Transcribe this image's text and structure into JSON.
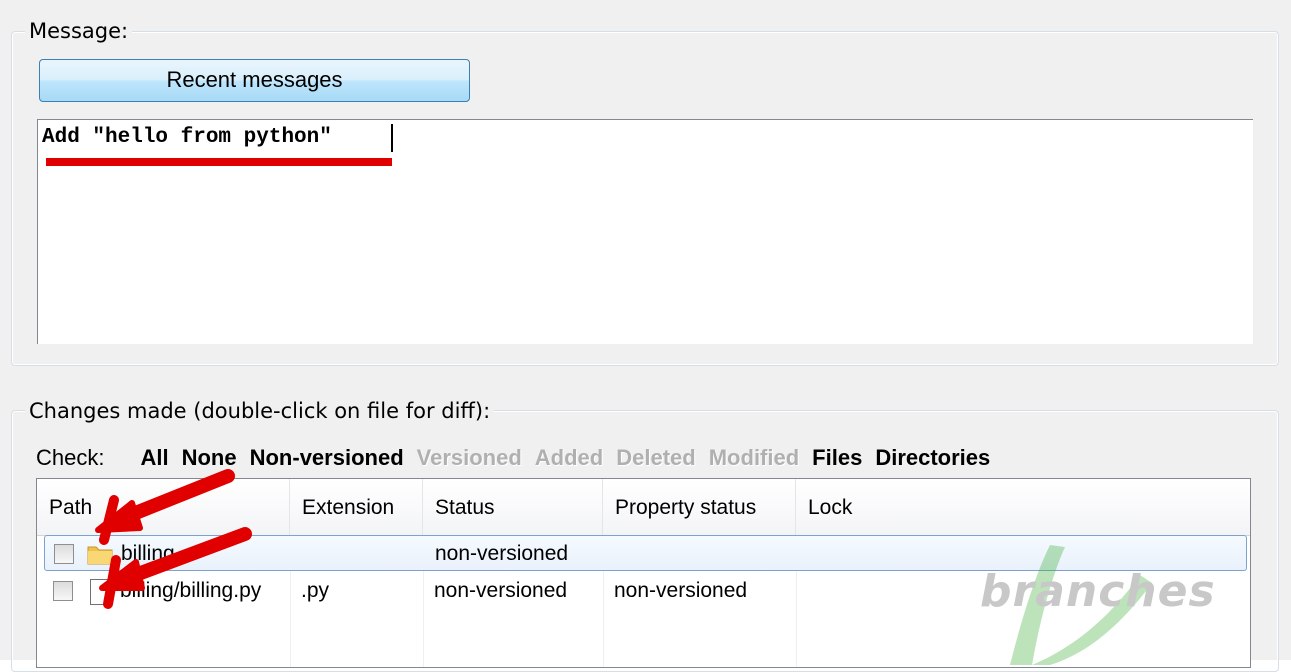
{
  "message_group": {
    "title": "Message:",
    "recent_button": "Recent messages",
    "message_text": "Add \"hello from python\""
  },
  "changes_group": {
    "title": "Changes made (double-click on file for diff):",
    "check_label": "Check:",
    "check_links": [
      {
        "label": "All",
        "enabled": true
      },
      {
        "label": "None",
        "enabled": true
      },
      {
        "label": "Non-versioned",
        "enabled": true
      },
      {
        "label": "Versioned",
        "enabled": false
      },
      {
        "label": "Added",
        "enabled": false
      },
      {
        "label": "Deleted",
        "enabled": false
      },
      {
        "label": "Modified",
        "enabled": false
      },
      {
        "label": "Files",
        "enabled": true
      },
      {
        "label": "Directories",
        "enabled": true
      }
    ],
    "columns": [
      "Path",
      "Extension",
      "Status",
      "Property status",
      "Lock"
    ],
    "rows": [
      {
        "path": "billing",
        "extension": "",
        "status": "non-versioned",
        "property_status": "",
        "lock": "",
        "icon": "folder-icon",
        "checked": false
      },
      {
        "path": "billing/billing.py",
        "extension": ".py",
        "status": "non-versioned",
        "property_status": "non-versioned",
        "lock": "",
        "icon": "file-icon",
        "checked": false
      }
    ]
  },
  "watermark": "branches",
  "colors": {
    "annotation_red": "#e00000",
    "button_border": "#3c7fb1",
    "selection_border": "#7da2ce",
    "watermark_green": "#3fae3a"
  }
}
